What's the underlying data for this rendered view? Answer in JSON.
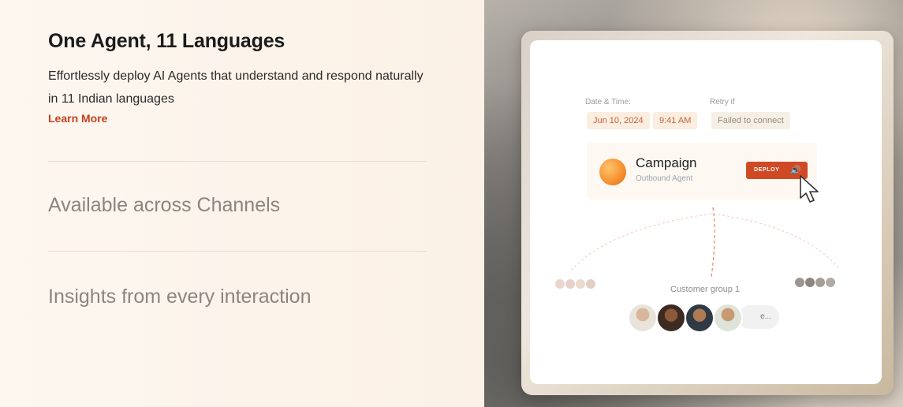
{
  "features": {
    "active": {
      "title": "One Agent, 11 Languages",
      "description": "Effortlessly deploy AI Agents that understand and respond naturally in 11 Indian languages",
      "link_label": "Learn More"
    },
    "items": [
      {
        "label": "Available across Channels"
      },
      {
        "label": "Insights from every interaction"
      }
    ]
  },
  "preview": {
    "date_time_label": "Date & Time:",
    "retry_label": "Retry if",
    "date": "Jun 10, 2024",
    "time": "9:41 AM",
    "retry_value": "Failed to connect",
    "campaign": {
      "title": "Campaign",
      "subtitle": "Outbound Agent",
      "button_label": "DEPLOY"
    },
    "group_label": "Customer group 1",
    "more_label": "e..."
  },
  "colors": {
    "accent": "#cf4a24",
    "link": "#c2411f",
    "muted_text": "#8b8580"
  }
}
